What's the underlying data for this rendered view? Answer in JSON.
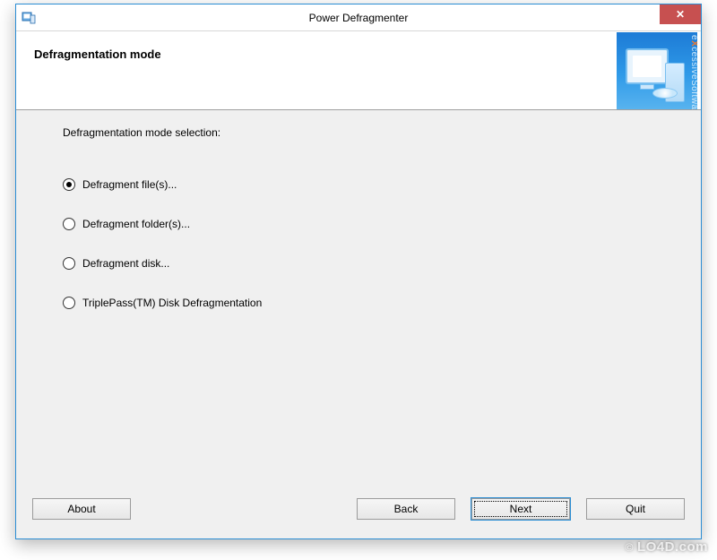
{
  "titlebar": {
    "title": "Power Defragmenter",
    "close_label": "✕"
  },
  "header": {
    "title": "Defragmentation mode",
    "brand_prefix": "e",
    "brand_x": "X",
    "brand_suffix": "cessive",
    "brand_line2": "Software"
  },
  "content": {
    "prompt": "Defragmentation mode selection:",
    "options": [
      {
        "label": "Defragment file(s)...",
        "selected": true
      },
      {
        "label": "Defragment folder(s)...",
        "selected": false
      },
      {
        "label": "Defragment disk...",
        "selected": false
      },
      {
        "label": "TriplePass(TM) Disk Defragmentation",
        "selected": false
      }
    ]
  },
  "buttons": {
    "about": "About",
    "back": "Back",
    "next": "Next",
    "quit": "Quit"
  },
  "watermark": {
    "copy": "©",
    "text": "LO4D.com"
  }
}
